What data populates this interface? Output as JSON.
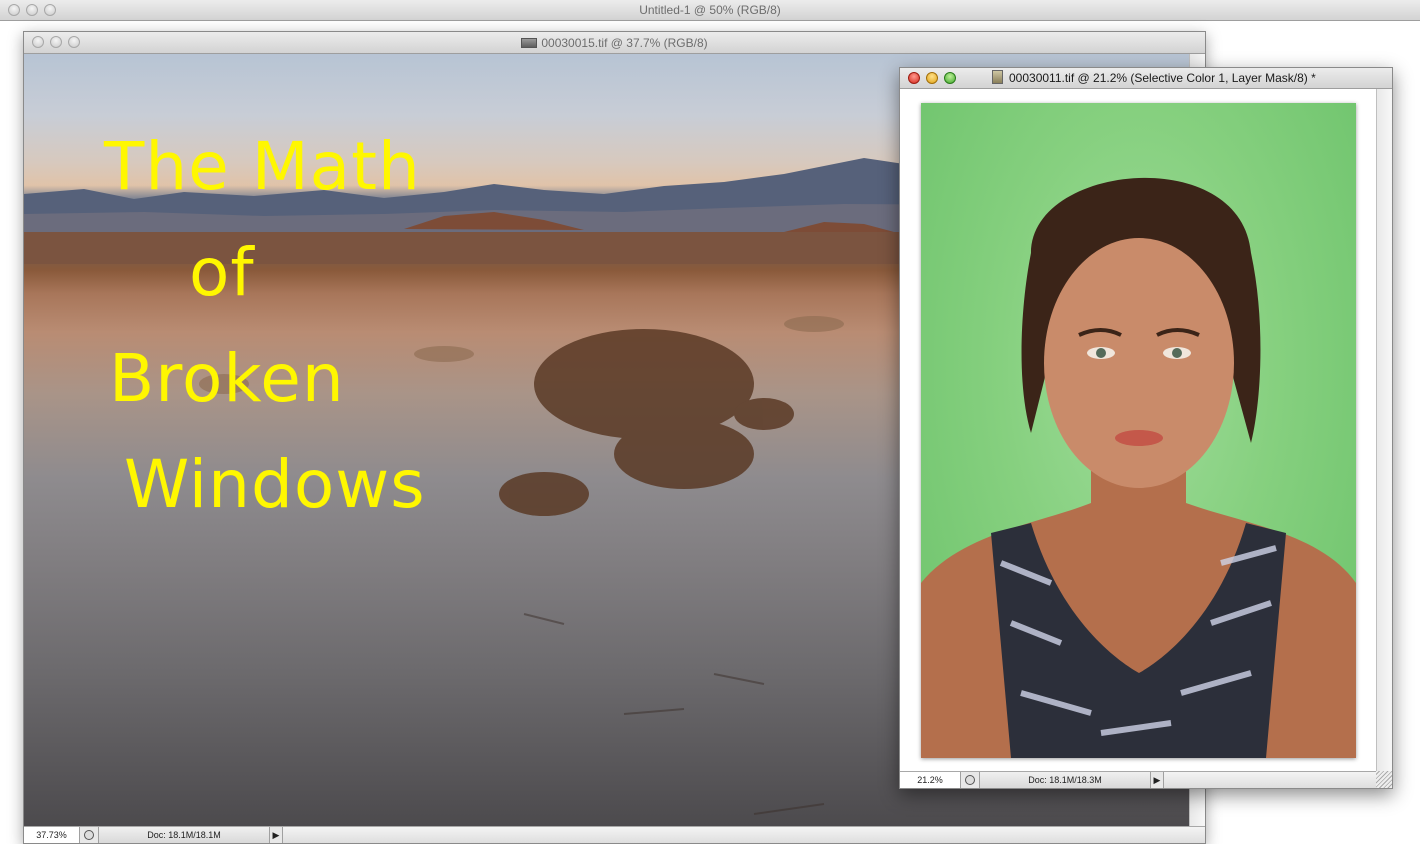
{
  "app_window": {
    "title": "Untitled-1 @ 50% (RGB/8)"
  },
  "landscape_doc": {
    "title": "00030015.tif @ 37.7% (RGB/8)",
    "overlay_text": [
      "The Math",
      "of",
      "Broken",
      "Windows"
    ],
    "overlay_color": "#fff700",
    "status": {
      "zoom": "37.73%",
      "doc_size": "Doc: 18.1M/18.1M"
    }
  },
  "portrait_doc": {
    "title": "00030011.tif @ 21.2% (Selective Color 1, Layer Mask/8) *",
    "status": {
      "zoom": "21.2%",
      "doc_size": "Doc: 18.1M/18.3M"
    },
    "background_color": "#86d07f"
  },
  "icons": {
    "close": "close-icon",
    "minimize": "minimize-icon",
    "zoom": "zoom-icon",
    "status_menu": "play-arrow-icon"
  }
}
